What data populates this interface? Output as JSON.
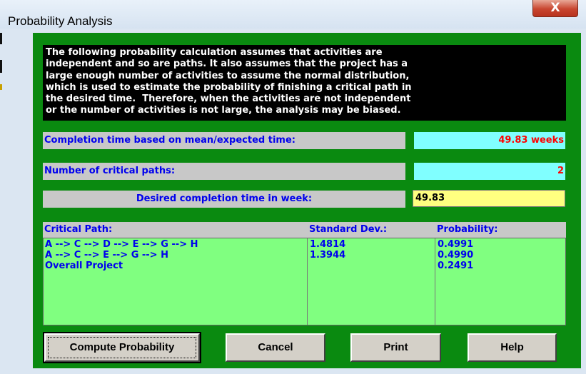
{
  "window": {
    "title": "Probability Analysis",
    "close_label": "X"
  },
  "notice": {
    "lines": [
      "The following probability calculation assumes that activities are",
      "independent and so are paths. It also assumes that the project has a",
      "large enough number of activities to assume the normal distribution,",
      "which is used to estimate the probability of finishing a critical path in",
      "the desired time.  Therefore, when the activities are not independent",
      "or the number of activities is not large, the analysis may be biased."
    ]
  },
  "fields": {
    "completion_label": "Completion time based on mean/expected time:",
    "completion_value": "49.83 weeks",
    "critical_paths_label": "Number of critical paths:",
    "critical_paths_value": "2",
    "desired_label": "Desired completion time in week:",
    "desired_value": "49.83"
  },
  "table": {
    "headers": {
      "path": "Critical Path:",
      "std": "Standard Dev.:",
      "prob": "Probability:"
    },
    "rows": [
      {
        "path": "A --> C --> D --> E --> G --> H",
        "std": "1.4814",
        "prob": "0.4991"
      },
      {
        "path": "A --> C --> E --> G --> H",
        "std": "1.3944",
        "prob": "0.4990"
      },
      {
        "path": "Overall Project",
        "std": "",
        "prob": "0.2491"
      }
    ]
  },
  "buttons": {
    "compute": "Compute Probability",
    "cancel": "Cancel",
    "print": "Print",
    "help": "Help"
  },
  "colors": {
    "panel": "#0a8a10",
    "label_bg": "#c8c8c8",
    "label_text": "#0000ee",
    "value_cyan": "#80ffff",
    "value_red": "#ff0000",
    "input_yellow": "#ffff80",
    "table_green": "#80ff80"
  }
}
